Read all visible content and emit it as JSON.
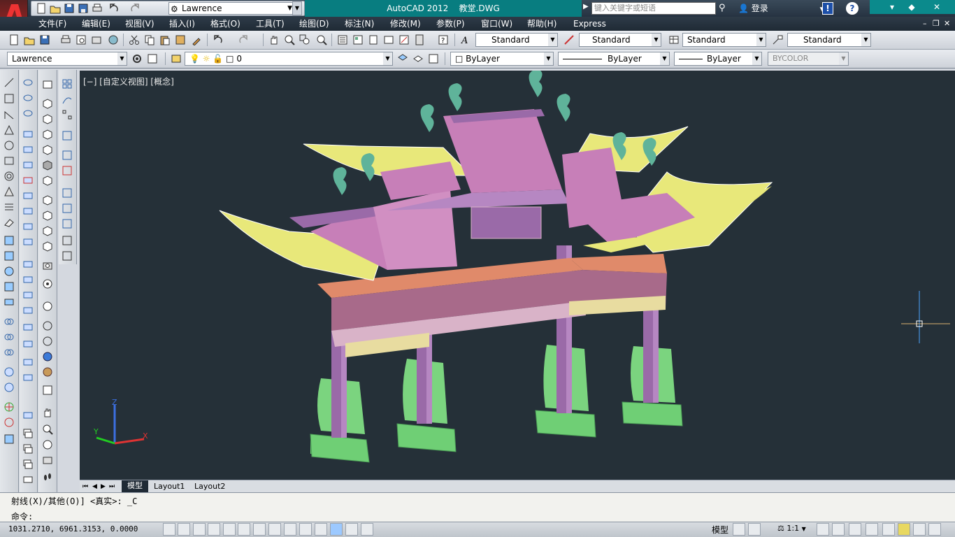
{
  "title": {
    "app": "AutoCAD 2012",
    "file": "教堂.DWG",
    "workspace": "Lawrence",
    "search_placeholder": "键入关键字或短语",
    "login": "登录"
  },
  "menu": [
    "文件(F)",
    "编辑(E)",
    "视图(V)",
    "插入(I)",
    "格式(O)",
    "工具(T)",
    "绘图(D)",
    "标注(N)",
    "修改(M)",
    "参数(P)",
    "窗口(W)",
    "帮助(H)",
    "Express"
  ],
  "toolbar1": {
    "text_style": "Standard",
    "dim_style": "Standard",
    "table_style": "Standard",
    "mleader_style": "Standard"
  },
  "toolbar2": {
    "workspace": "Lawrence",
    "layer": "0",
    "color": "ByLayer",
    "linetype": "ByLayer",
    "lineweight": "ByLayer",
    "plotstyle": "BYCOLOR"
  },
  "viewport": {
    "label": "[−] [自定义视图] [概念]",
    "background": "#253038",
    "ucs": {
      "x": "X",
      "y": "Y",
      "z": "Z"
    }
  },
  "tabs": [
    "模型",
    "Layout1",
    "Layout2"
  ],
  "command": {
    "history": "射线(X)/其他(O)] <真实>: _C",
    "prompt": "命令:"
  },
  "status": {
    "coords": "1031.2710,   6961.3153,  0.0000",
    "space": "模型",
    "scale": "1:1"
  },
  "colors": {
    "titlebar_accent": "#087d80",
    "roof_pink": "#c77fb8",
    "roof_yellow": "#e8e87a",
    "base_green": "#6fcf75",
    "pillar_purple": "#9a6aa8",
    "beam_orange": "#e08a6a"
  }
}
